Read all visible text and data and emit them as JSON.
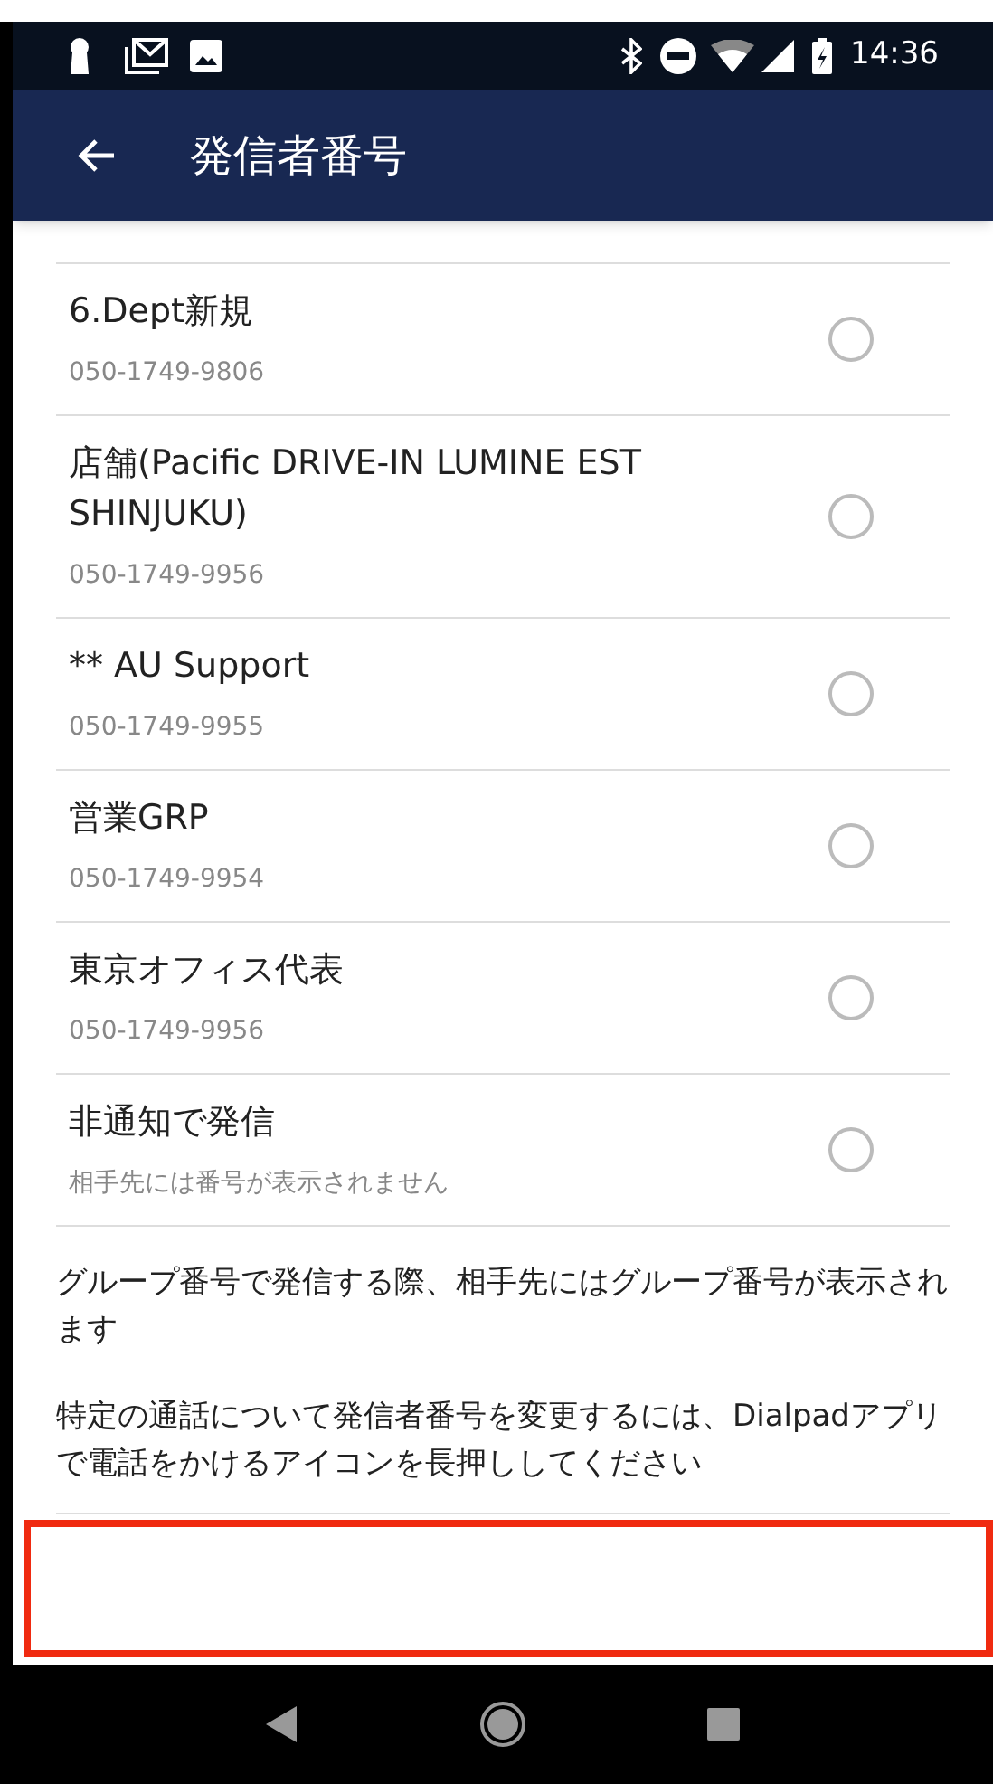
{
  "status_bar": {
    "time": "14:36"
  },
  "app_bar": {
    "title": "発信者番号"
  },
  "numbers": [
    {
      "name": "6.Dept新規",
      "number": "050-1749-9806",
      "selected": false
    },
    {
      "name": "店舗(Pacific DRIVE-IN LUMINE EST SHINJUKU)",
      "number": "050-1749-9956",
      "selected": false
    },
    {
      "name": "** AU Support",
      "number": "050-1749-9955",
      "selected": false
    },
    {
      "name": "営業GRP",
      "number": "050-1749-9954",
      "selected": false
    },
    {
      "name": "東京オフィス代表",
      "number": "050-1749-9956",
      "selected": false
    },
    {
      "name": "非通知で発信",
      "number": "相手先には番号が表示されません",
      "selected": false
    }
  ],
  "notes": [
    "グループ番号で発信する際、相手先にはグループ番号が表示されます",
    "特定の通話について発信者番号を変更するには、Dialpadアプリで電話をかけるアイコンを長押ししてください"
  ]
}
